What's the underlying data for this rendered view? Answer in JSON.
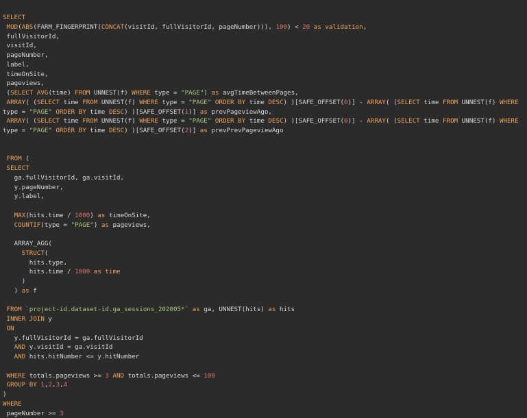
{
  "colors": {
    "background": "#2b2b2b",
    "keyword": "#f0a35a",
    "string": "#a8c77a",
    "number": "#e0726a",
    "text": "#d8d8d8"
  },
  "lines": [
    [
      [
        "kw",
        "SELECT"
      ]
    ],
    [
      [
        "txt",
        " "
      ],
      [
        "fn",
        "MOD"
      ],
      [
        "txt",
        "("
      ],
      [
        "fn",
        "ABS"
      ],
      [
        "txt",
        "("
      ],
      [
        "txt",
        "FARM_FINGERPRINT"
      ],
      [
        "txt",
        "("
      ],
      [
        "fn",
        "CONCAT"
      ],
      [
        "txt",
        "(visitId, fullVisitorId, pageNumber))), "
      ],
      [
        "num",
        "100"
      ],
      [
        "txt",
        ") < "
      ],
      [
        "num",
        "20"
      ],
      [
        "kw",
        " as "
      ],
      [
        "kw",
        "validation"
      ],
      [
        "txt",
        ","
      ]
    ],
    [
      [
        "txt",
        " fullVisitorId,"
      ]
    ],
    [
      [
        "txt",
        " visitId,"
      ]
    ],
    [
      [
        "txt",
        " pageNumber,"
      ]
    ],
    [
      [
        "txt",
        " label,"
      ]
    ],
    [
      [
        "txt",
        " timeOnSite,"
      ]
    ],
    [
      [
        "txt",
        " pageviews,"
      ]
    ],
    [
      [
        "txt",
        " ("
      ],
      [
        "kw",
        "SELECT"
      ],
      [
        "txt",
        " "
      ],
      [
        "fn",
        "AVG"
      ],
      [
        "txt",
        "(time) "
      ],
      [
        "kw",
        "FROM"
      ],
      [
        "txt",
        " UNNEST(f) "
      ],
      [
        "kw",
        "WHERE"
      ],
      [
        "txt",
        " type = "
      ],
      [
        "str",
        "\"PAGE\""
      ],
      [
        "txt",
        ") "
      ],
      [
        "kw",
        "as"
      ],
      [
        "txt",
        " avgTimeBetweenPages,"
      ]
    ],
    [
      [
        "txt",
        " "
      ],
      [
        "kw",
        "ARRAY"
      ],
      [
        "txt",
        "( ("
      ],
      [
        "kw",
        "SELECT"
      ],
      [
        "txt",
        " time "
      ],
      [
        "kw",
        "FROM"
      ],
      [
        "txt",
        " UNNEST(f) "
      ],
      [
        "kw",
        "WHERE"
      ],
      [
        "txt",
        " type = "
      ],
      [
        "str",
        "\"PAGE\""
      ],
      [
        "txt",
        " "
      ],
      [
        "kw",
        "ORDER BY"
      ],
      [
        "txt",
        " time "
      ],
      [
        "kw",
        "DESC"
      ],
      [
        "txt",
        ") )[SAFE_OFFSET("
      ],
      [
        "num",
        "0"
      ],
      [
        "txt",
        ")] - "
      ],
      [
        "kw",
        "ARRAY"
      ],
      [
        "txt",
        "( ("
      ],
      [
        "kw",
        "SELECT"
      ],
      [
        "txt",
        " time "
      ],
      [
        "kw",
        "FROM"
      ],
      [
        "txt",
        " UNNEST(f) "
      ],
      [
        "kw",
        "WHERE"
      ]
    ],
    [
      [
        "txt",
        "type = "
      ],
      [
        "str",
        "\"PAGE\""
      ],
      [
        "txt",
        " "
      ],
      [
        "kw",
        "ORDER BY"
      ],
      [
        "txt",
        " time "
      ],
      [
        "kw",
        "DESC"
      ],
      [
        "txt",
        ") )[SAFE_OFFSET("
      ],
      [
        "num",
        "1"
      ],
      [
        "txt",
        ")] "
      ],
      [
        "kw",
        "as"
      ],
      [
        "txt",
        " prevPageviewAgo,"
      ]
    ],
    [
      [
        "txt",
        " "
      ],
      [
        "kw",
        "ARRAY"
      ],
      [
        "txt",
        "( ("
      ],
      [
        "kw",
        "SELECT"
      ],
      [
        "txt",
        " time "
      ],
      [
        "kw",
        "FROM"
      ],
      [
        "txt",
        " UNNEST(f) "
      ],
      [
        "kw",
        "WHERE"
      ],
      [
        "txt",
        " type = "
      ],
      [
        "str",
        "\"PAGE\""
      ],
      [
        "txt",
        " "
      ],
      [
        "kw",
        "ORDER BY"
      ],
      [
        "txt",
        " time "
      ],
      [
        "kw",
        "DESC"
      ],
      [
        "txt",
        ") )[SAFE_OFFSET("
      ],
      [
        "num",
        "0"
      ],
      [
        "txt",
        ")] - "
      ],
      [
        "kw",
        "ARRAY"
      ],
      [
        "txt",
        "( ("
      ],
      [
        "kw",
        "SELECT"
      ],
      [
        "txt",
        " time "
      ],
      [
        "kw",
        "FROM"
      ],
      [
        "txt",
        " UNNEST(f) "
      ],
      [
        "kw",
        "WHERE"
      ]
    ],
    [
      [
        "txt",
        "type = "
      ],
      [
        "str",
        "\"PAGE\""
      ],
      [
        "txt",
        " "
      ],
      [
        "kw",
        "ORDER BY"
      ],
      [
        "txt",
        " time "
      ],
      [
        "kw",
        "DESC"
      ],
      [
        "txt",
        ") )[SAFE_OFFSET("
      ],
      [
        "num",
        "2"
      ],
      [
        "txt",
        ")] "
      ],
      [
        "kw",
        "as"
      ],
      [
        "txt",
        " prevPrevPageviewAgo"
      ]
    ],
    [],
    [],
    [
      [
        "txt",
        " "
      ],
      [
        "kw",
        "FROM"
      ],
      [
        "txt",
        " ("
      ]
    ],
    [
      [
        "txt",
        " "
      ],
      [
        "kw",
        "SELECT"
      ]
    ],
    [
      [
        "txt",
        "   ga.fullVisitorId, ga.visitId,"
      ]
    ],
    [
      [
        "txt",
        "   y.pageNumber,"
      ]
    ],
    [
      [
        "txt",
        "   y.label,"
      ]
    ],
    [],
    [
      [
        "txt",
        "   "
      ],
      [
        "fn",
        "MAX"
      ],
      [
        "txt",
        "(hits.time / "
      ],
      [
        "num",
        "1000"
      ],
      [
        "txt",
        ") "
      ],
      [
        "kw",
        "as"
      ],
      [
        "txt",
        " timeOnSite,"
      ]
    ],
    [
      [
        "txt",
        "   "
      ],
      [
        "fn",
        "COUNTIF"
      ],
      [
        "txt",
        "(type = "
      ],
      [
        "str",
        "\"PAGE\""
      ],
      [
        "txt",
        ") "
      ],
      [
        "kw",
        "as"
      ],
      [
        "txt",
        " pageviews,"
      ]
    ],
    [],
    [
      [
        "txt",
        "   ARRAY_AGG("
      ]
    ],
    [
      [
        "txt",
        "     "
      ],
      [
        "fn",
        "STRUCT"
      ],
      [
        "txt",
        "("
      ]
    ],
    [
      [
        "txt",
        "       hits.type,"
      ]
    ],
    [
      [
        "txt",
        "       hits.time / "
      ],
      [
        "num",
        "1000"
      ],
      [
        "kw",
        " as time"
      ]
    ],
    [
      [
        "txt",
        "     )"
      ]
    ],
    [
      [
        "txt",
        "   ) "
      ],
      [
        "kw",
        "as"
      ],
      [
        "txt",
        " f"
      ]
    ],
    [],
    [
      [
        "txt",
        " "
      ],
      [
        "kw",
        "FROM"
      ],
      [
        "txt",
        " "
      ],
      [
        "str",
        "`project-id.dataset-id.ga_sessions_202005*`"
      ],
      [
        "txt",
        " "
      ],
      [
        "kw",
        "as"
      ],
      [
        "txt",
        " ga, UNNEST(hits) "
      ],
      [
        "kw",
        "as"
      ],
      [
        "txt",
        " hits"
      ]
    ],
    [
      [
        "txt",
        " "
      ],
      [
        "kw",
        "INNER JOIN"
      ],
      [
        "txt",
        " y"
      ]
    ],
    [
      [
        "txt",
        " "
      ],
      [
        "kw",
        "ON"
      ]
    ],
    [
      [
        "txt",
        "   y.fullVisitorId = ga.fullVisitorId"
      ]
    ],
    [
      [
        "txt",
        "   "
      ],
      [
        "kw",
        "AND"
      ],
      [
        "txt",
        " y.visitId = ga.visitId"
      ]
    ],
    [
      [
        "txt",
        "   "
      ],
      [
        "kw",
        "AND"
      ],
      [
        "txt",
        " hits.hitNumber <= y.hitNumber"
      ]
    ],
    [],
    [
      [
        "txt",
        " "
      ],
      [
        "kw",
        "WHERE"
      ],
      [
        "txt",
        " totals.pageviews >= "
      ],
      [
        "num",
        "3"
      ],
      [
        "txt",
        " "
      ],
      [
        "kw",
        "AND"
      ],
      [
        "txt",
        " totals.pageviews <= "
      ],
      [
        "num",
        "100"
      ]
    ],
    [
      [
        "txt",
        " "
      ],
      [
        "kw",
        "GROUP BY"
      ],
      [
        "txt",
        " "
      ],
      [
        "num",
        "1"
      ],
      [
        "txt",
        ","
      ],
      [
        "num",
        "2"
      ],
      [
        "txt",
        ","
      ],
      [
        "num",
        "3"
      ],
      [
        "txt",
        ","
      ],
      [
        "num",
        "4"
      ]
    ],
    [
      [
        "txt",
        ")"
      ]
    ],
    [
      [
        "kw",
        "WHERE"
      ]
    ],
    [
      [
        "txt",
        " pageNumber >= "
      ],
      [
        "num",
        "3"
      ]
    ]
  ]
}
